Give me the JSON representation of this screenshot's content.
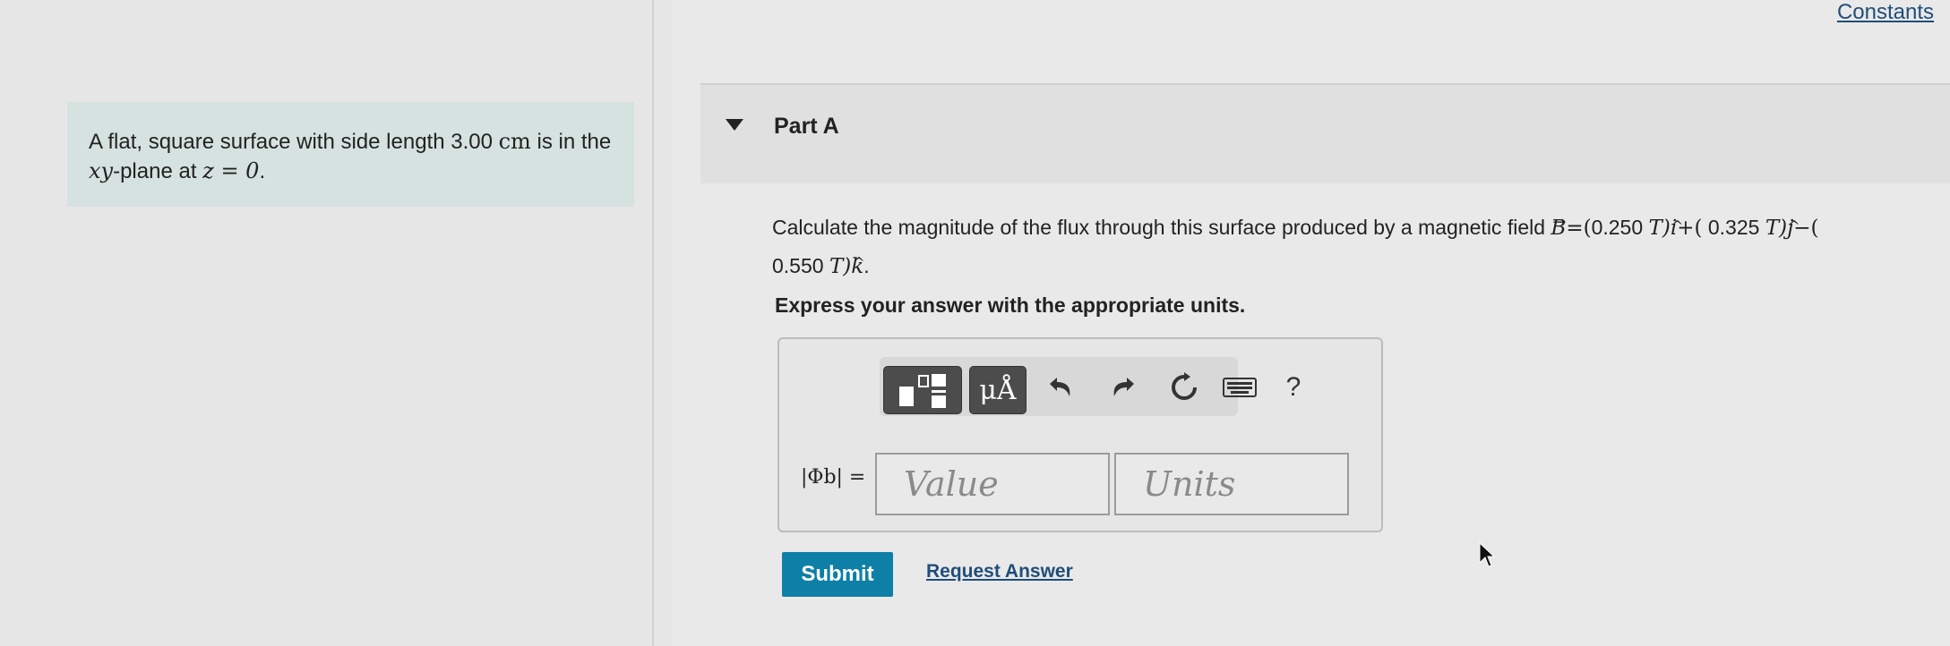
{
  "header": {
    "constants_link": "Constants"
  },
  "problem": {
    "text_before": "A flat, square surface with side length 3.00",
    "unit": "cm",
    "text_mid": "is in the",
    "plane": "xy",
    "text_plane": "-plane at",
    "z_eq": "z = 0",
    "period": "."
  },
  "part": {
    "title": "Part A",
    "expanded": true
  },
  "question": {
    "text": "Calculate the magnitude of the flux through this surface produced by a magnetic field",
    "b_vec": "B",
    "eq_1": "=(",
    "bx": "0.250",
    "t1": "T)",
    "ihat": "i",
    "plus_1": "+(",
    "by": "0.325",
    "t2": "T)",
    "jhat": "j",
    "minus": "−(",
    "bz": "0.550",
    "t3": "T)",
    "khat": "k",
    "period": "."
  },
  "instruction": "Express your answer with the appropriate units.",
  "toolbar": {
    "units_label": "μÅ",
    "help_label": "?",
    "icons": [
      "templates-icon",
      "units-icon",
      "undo-icon",
      "redo-icon",
      "reset-icon",
      "keyboard-icon",
      "help-icon"
    ]
  },
  "answer": {
    "label": "|Φb| =",
    "value_placeholder": "Value",
    "units_placeholder": "Units"
  },
  "actions": {
    "submit_label": "Submit",
    "request_answer_label": "Request Answer"
  },
  "colors": {
    "problem_bg": "#d5e2df",
    "submit_bg": "#0e7fa6",
    "link": "#1f4e79"
  }
}
